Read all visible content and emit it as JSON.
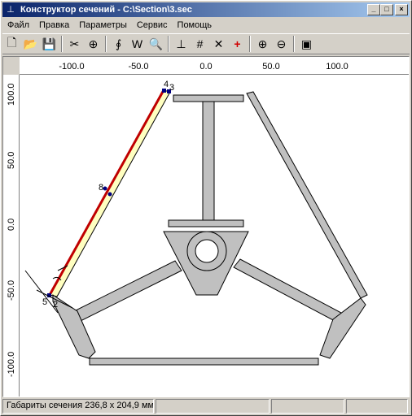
{
  "window": {
    "title": "Конструктор сечений - C:\\Section\\3.sec",
    "app_icon": "app-icon",
    "controls": {
      "minimize": "_",
      "maximize": "□",
      "close": "×"
    }
  },
  "menu": [
    "Файл",
    "Правка",
    "Параметры",
    "Сервис",
    "Помощь"
  ],
  "toolbar": [
    {
      "name": "new-file-icon",
      "glyph": "🗋"
    },
    {
      "name": "open-file-icon",
      "glyph": "📂"
    },
    {
      "name": "save-icon",
      "glyph": "💾"
    },
    {
      "sep": true
    },
    {
      "name": "cut-icon",
      "glyph": "✂"
    },
    {
      "name": "center-target-icon",
      "glyph": "⊕"
    },
    {
      "sep": true
    },
    {
      "name": "integral-icon",
      "glyph": "∮"
    },
    {
      "name": "w-char-icon",
      "glyph": "W"
    },
    {
      "name": "preview-icon",
      "glyph": "🔍"
    },
    {
      "sep": true
    },
    {
      "name": "axes-icon",
      "glyph": "⊥"
    },
    {
      "name": "grid-icon",
      "glyph": "#"
    },
    {
      "name": "snap-icon",
      "glyph": "✕"
    },
    {
      "name": "add-point-icon",
      "glyph": "+"
    },
    {
      "sep": true
    },
    {
      "name": "zoom-in-icon",
      "glyph": "⊕"
    },
    {
      "name": "zoom-out-icon",
      "glyph": "⊖"
    },
    {
      "sep": true
    },
    {
      "name": "calc-icon",
      "glyph": "▣"
    }
  ],
  "ruler": {
    "h_labels": [
      "-100.0",
      "-50.0",
      "0.0",
      "50.0",
      "100.0"
    ],
    "v_labels": [
      "100.0",
      "50.0",
      "0.0",
      "-50.0",
      "-100.0"
    ]
  },
  "point_labels": [
    "4",
    "3",
    "8",
    "5",
    "2"
  ],
  "status": {
    "dimensions": "Габариты сечения 236,8 x 204,9 мм",
    "cell2": "",
    "cell3": "",
    "cell4": ""
  },
  "colors": {
    "title_start": "#0a246a",
    "section_fill": "#c0c0c0",
    "selected_plate_fill": "#ffffc0",
    "selected_edge": "#c00000",
    "point_marker": "#000080"
  }
}
